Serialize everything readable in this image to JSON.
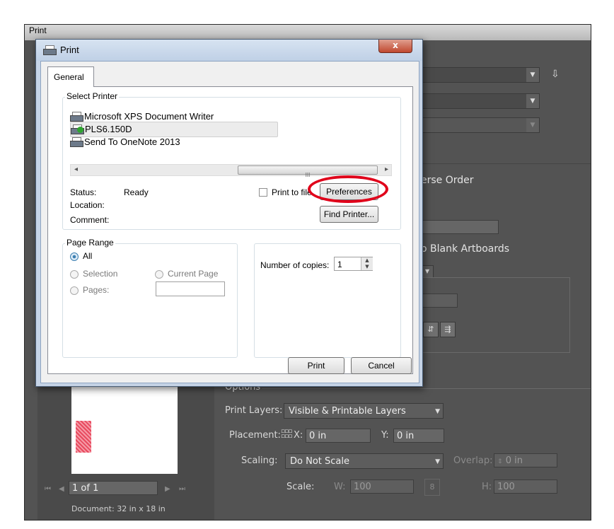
{
  "background_window": {
    "title": "Print",
    "reverse_order_text": "erse Order",
    "blank_artboards_text": "o Blank Artboards",
    "options": {
      "section_label": "Options",
      "print_layers_label": "Print Layers:",
      "print_layers_value": "Visible & Printable Layers",
      "placement_label": "Placement:",
      "x_label": "X:",
      "x_value": "0 in",
      "y_label": "Y:",
      "y_value": "0 in",
      "scaling_label": "Scaling:",
      "scaling_value": "Do Not Scale",
      "overlap_label": "Overlap:",
      "overlap_value": "0 in",
      "scale_label": "Scale:",
      "w_label": "W:",
      "w_value": "100",
      "h_label": "H:",
      "h_value": "100"
    },
    "preview": {
      "page_field": "1 of 1",
      "document_size": "Document: 32 in x 18 in"
    }
  },
  "print_dialog": {
    "title": "Print",
    "close_label": "x",
    "tab_general": "General",
    "select_printer": {
      "group_label": "Select Printer",
      "printers": [
        "Microsoft XPS Document Writer",
        "PLS6.150D",
        "Send To OneNote 2013"
      ],
      "selected_printer": "PLS6.150D",
      "scroll_left": "◂",
      "scroll_right": "▸",
      "scroll_thumb": "III",
      "status_label": "Status:",
      "status_value": "Ready",
      "location_label": "Location:",
      "comment_label": "Comment:",
      "print_to_file": "Print to file",
      "preferences_button": "Preferences",
      "find_printer_button": "Find Printer..."
    },
    "page_range": {
      "group_label": "Page Range",
      "all": "All",
      "selection": "Selection",
      "current_page": "Current Page",
      "pages": "Pages:",
      "pages_value": "",
      "selected": "All"
    },
    "copies": {
      "label": "Number of copies:",
      "value": "1"
    },
    "print_button": "Print",
    "cancel_button": "Cancel"
  },
  "annotation": {
    "highlight_color": "#e0001a",
    "highlight_target": "Preferences"
  }
}
